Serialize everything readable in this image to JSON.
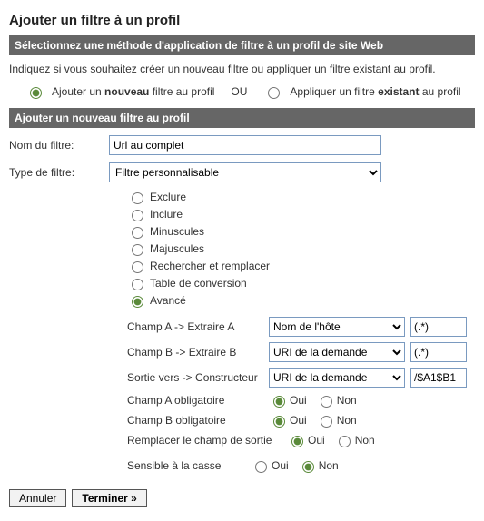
{
  "page_title": "Ajouter un filtre à un profil",
  "method_section": {
    "bar": "Sélectionnez une méthode d'application de filtre à un profil de site Web",
    "intro": "Indiquez si vous souhaitez créer un nouveau filtre ou appliquer un filtre existant au profil.",
    "new_label_pre": "Ajouter un ",
    "new_label_bold": "nouveau",
    "new_label_post": " filtre au profil",
    "or": "OU",
    "existing_label_pre": "Appliquer un filtre ",
    "existing_label_bold": "existant",
    "existing_label_post": " au profil"
  },
  "filter_section": {
    "bar": "Ajouter un nouveau filtre au profil",
    "name_label": "Nom du filtre:",
    "name_value": "Url au complet",
    "type_label": "Type de filtre:",
    "type_value": "Filtre personnalisable",
    "type_options": [
      {
        "label": "Exclure"
      },
      {
        "label": "Inclure"
      },
      {
        "label": "Minuscules"
      },
      {
        "label": "Majuscules"
      },
      {
        "label": "Rechercher et remplacer"
      },
      {
        "label": "Table de conversion"
      },
      {
        "label": "Avancé"
      }
    ],
    "advanced": {
      "champ_a_label": "Champ A -> Extraire A",
      "champ_a_select": "Nom de l'hôte",
      "champ_a_value": "(.*)",
      "champ_b_label": "Champ B -> Extraire B",
      "champ_b_select": "URI de la demande",
      "champ_b_value": "(.*)",
      "sortie_label": "Sortie vers -> Constructeur",
      "sortie_select": "URI de la demande",
      "sortie_value": "/$A1$B1",
      "oblig_a_label": "Champ A obligatoire",
      "oblig_b_label": "Champ B obligatoire",
      "remplacer_label": "Remplacer le champ de sortie",
      "casse_label": "Sensible à la casse",
      "oui": "Oui",
      "non": "Non"
    }
  },
  "buttons": {
    "cancel": "Annuler",
    "submit": "Terminer »"
  }
}
